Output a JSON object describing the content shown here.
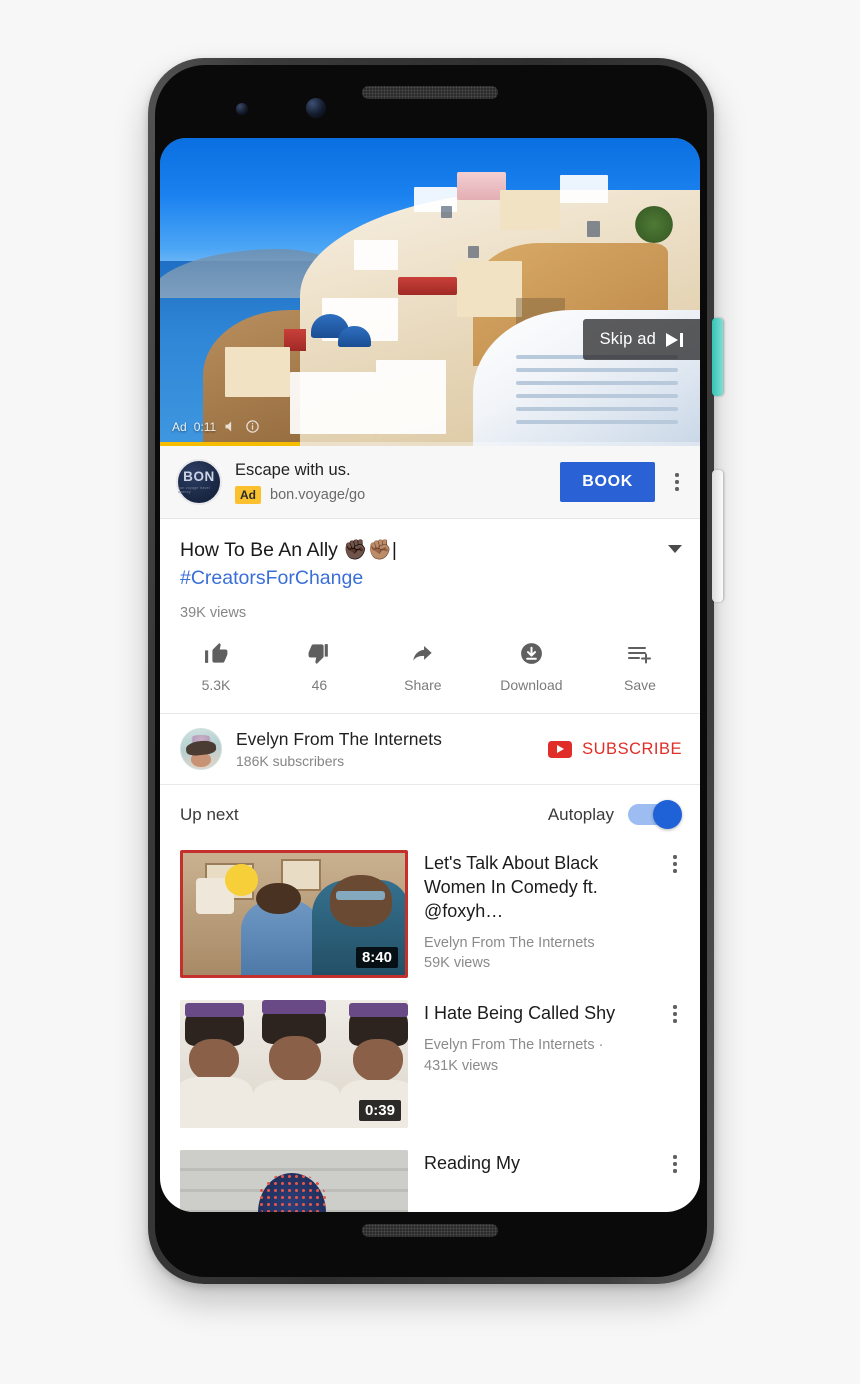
{
  "device": {
    "name": "android-phone-mockup"
  },
  "player": {
    "skip_ad_label": "Skip ad",
    "ad_badge": "Ad",
    "ad_time": "0:11",
    "ad_progress_percent": 26,
    "scene_description": "Santorini cliffside white village overlooking blue sea"
  },
  "ad_banner": {
    "advertiser_logo_text": "BON",
    "advertiser_logo_tagline": "bon voyage travel agency",
    "headline": "Escape with us.",
    "ad_label": "Ad",
    "display_url": "bon.voyage/go",
    "cta_label": "BOOK",
    "overflow_label": "More options"
  },
  "video": {
    "title_main": "How To Be An Ally ✊🏿✊🏽|",
    "title_hashtag": "#CreatorsForChange",
    "view_count": "39K views",
    "actions": [
      {
        "label": "5.3K",
        "icon": "thumbs-up-icon",
        "name": "like-button"
      },
      {
        "label": "46",
        "icon": "thumbs-down-icon",
        "name": "dislike-button"
      },
      {
        "label": "Share",
        "icon": "share-arrow-icon",
        "name": "share-button"
      },
      {
        "label": "Download",
        "icon": "download-circle-icon",
        "name": "download-button"
      },
      {
        "label": "Save",
        "icon": "save-playlist-icon",
        "name": "save-button"
      }
    ]
  },
  "channel": {
    "name": "Evelyn From The Internets",
    "subscribers": "186K subscribers",
    "subscribe_label": "SUBSCRIBE",
    "subscribe_color": "#e02d27"
  },
  "up_next": {
    "header_label": "Up next",
    "autoplay_label": "Autoplay",
    "autoplay_on": true,
    "autoplay_accent": "#1f62d8",
    "items": [
      {
        "title": "Let's Talk About Black Women In Comedy ft. @foxyh…",
        "channel": "Evelyn From The Internets",
        "views": "59K views",
        "duration": "8:40",
        "active": true
      },
      {
        "title": "I Hate Being Called Shy",
        "channel": "Evelyn From The Internets ·",
        "views": "431K views",
        "duration": "0:39",
        "active": false
      },
      {
        "title": "Reading My",
        "channel": "",
        "views": "",
        "duration": "",
        "active": false
      }
    ]
  }
}
